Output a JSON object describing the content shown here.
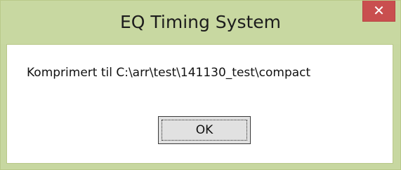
{
  "window": {
    "title": "EQ Timing System",
    "close_label": "✕"
  },
  "dialog": {
    "message": "Komprimert til C:\\arr\\test\\141130_test\\compact",
    "ok_label": "OK"
  },
  "colors": {
    "titlebar": "#c8d8a1",
    "close_button": "#c94f4f",
    "content_bg": "#ffffff",
    "button_bg": "#e1e1e1"
  }
}
